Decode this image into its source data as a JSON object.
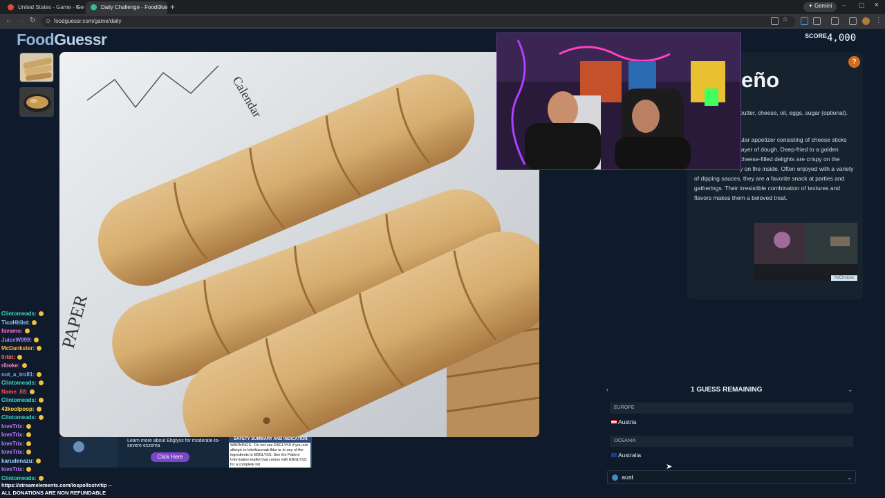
{
  "browser": {
    "tabs": [
      {
        "title": "United States - Game - Geo"
      },
      {
        "title": "Daily Challenge - FoodGuessr |"
      }
    ],
    "gemini_label": "Gemini",
    "url": "foodguessr.com/game/daily"
  },
  "header": {
    "logo_food": "Food",
    "logo_guessr": "Guessr",
    "score_label": "SCORE",
    "score_value": "4,000"
  },
  "dish": {
    "title_partial": "eño",
    "ingredients_partial": "butter, cheese, oil, eggs, sugar (optional).",
    "description_lines": [
      "ular appetizer consisting of cheese sticks",
      "layer of dough. Deep-fried to a golden",
      "cheese-filled delights are crispy on the",
      "y on the inside. Often enjoyed with a variety",
      "of dipping sauces, they are a favorite snack at parties and",
      "gatherings. Their irresistible combination of textures and",
      "flavors makes them a beloved treat."
    ],
    "help_icon": "?"
  },
  "guess_panel": {
    "title": "1 GUESS REMAINING",
    "results": [
      {
        "region": "EUROPE",
        "country": "Austria"
      },
      {
        "region": "OCEANIA",
        "country": "Australia"
      }
    ],
    "search_value": "aust"
  },
  "ads": {
    "small_ad_choice": "AdChoices",
    "bottom_learn": "Learn more about Ebglyss for moderate-to-severe eczema",
    "bottom_click": "Click Here",
    "safety_title": "SAFETY SUMMARY AND INDICATION",
    "safety_text": "WARNINGS - Do not use EBGLYSS if you are allergic to lebrikizumab-lbkz or to any of the ingredients in EBGLYSS. See the Patient Information leaflet that comes with EBGLYSS for a complete list"
  },
  "chat": [
    {
      "user": "Clintomeads:",
      "color": "#3fd6c6"
    },
    {
      "user": "TicoHitlist:",
      "color": "#8fd0ff"
    },
    {
      "user": "favamo:",
      "color": "#ff6bd6"
    },
    {
      "user": "JuiceW999:",
      "color": "#a78bff"
    },
    {
      "user": "McDankster:",
      "color": "#ffb347"
    },
    {
      "user": "0rbit:",
      "color": "#ff6b6b"
    },
    {
      "user": "riboke:",
      "color": "#ff8ad1"
    },
    {
      "user": "not_a_troll1:",
      "color": "#7fb2ff"
    },
    {
      "user": "Clintomeads:",
      "color": "#3fd6c6"
    },
    {
      "user": "Name_88:",
      "color": "#ff4d4d"
    },
    {
      "user": "Clintomeads:",
      "color": "#3fd6c6"
    },
    {
      "user": "43koolpoop:",
      "color": "#ffd84d"
    },
    {
      "user": "Clintomeads:",
      "color": "#3fd6c6"
    },
    {
      "user": "loveTrix:",
      "color": "#c77dff"
    },
    {
      "user": "loveTrix:",
      "color": "#c77dff"
    },
    {
      "user": "loveTrix:",
      "color": "#c77dff"
    },
    {
      "user": "loveTrix:",
      "color": "#c77dff"
    },
    {
      "user": "karudenazu:",
      "color": "#9fd4ff"
    },
    {
      "user": "loveTrix:",
      "color": "#c77dff"
    },
    {
      "user": "Clintomeads:",
      "color": "#3fd6c6"
    }
  ],
  "footer": {
    "tip_line": "https://streamelements.com/lospollostv/tip --",
    "refund_line": "ALL DONATIONS ARE NON REFUNDABLE"
  },
  "colors": {
    "page_bg": "#0f1b2b",
    "accent_orange": "#d26d1e",
    "panel_bg": "#17222f"
  }
}
